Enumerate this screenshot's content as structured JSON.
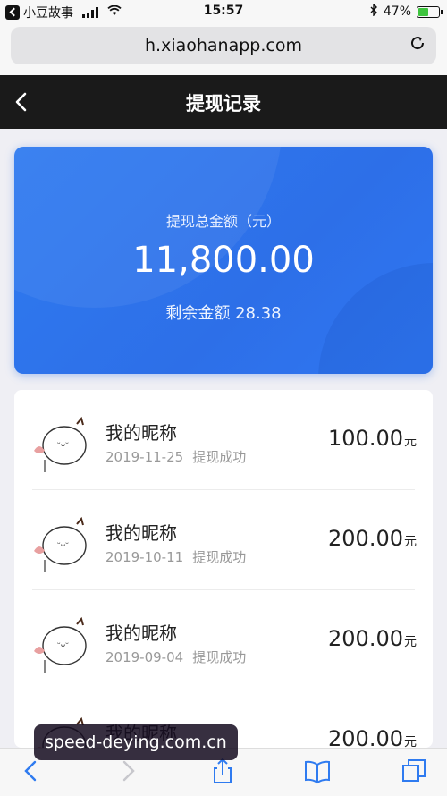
{
  "status_bar": {
    "back_app": "小豆故事",
    "time": "15:57",
    "battery": "47%",
    "battery_level": 0.47
  },
  "browser": {
    "url": "h.xiaohanapp.com"
  },
  "header": {
    "title": "提现记录"
  },
  "summary": {
    "label": "提现总金额（元）",
    "amount": "11,800.00",
    "remaining_label": "剩余金额",
    "remaining_value": "28.38"
  },
  "records": [
    {
      "name": "我的昵称",
      "date": "2019-11-25",
      "status": "提现成功",
      "amount": "100.00",
      "unit": "元"
    },
    {
      "name": "我的昵称",
      "date": "2019-10-11",
      "status": "提现成功",
      "amount": "200.00",
      "unit": "元"
    },
    {
      "name": "我的昵称",
      "date": "2019-09-04",
      "status": "提现成功",
      "amount": "200.00",
      "unit": "元"
    },
    {
      "name": "我的昵称",
      "date": "",
      "status": "",
      "amount": "200.00",
      "unit": "元"
    }
  ],
  "watermark": "speed-deying.com.cn",
  "colors": {
    "card": "#2f7bf0",
    "header": "#1a1a1a",
    "battery": "#3ec43e"
  }
}
